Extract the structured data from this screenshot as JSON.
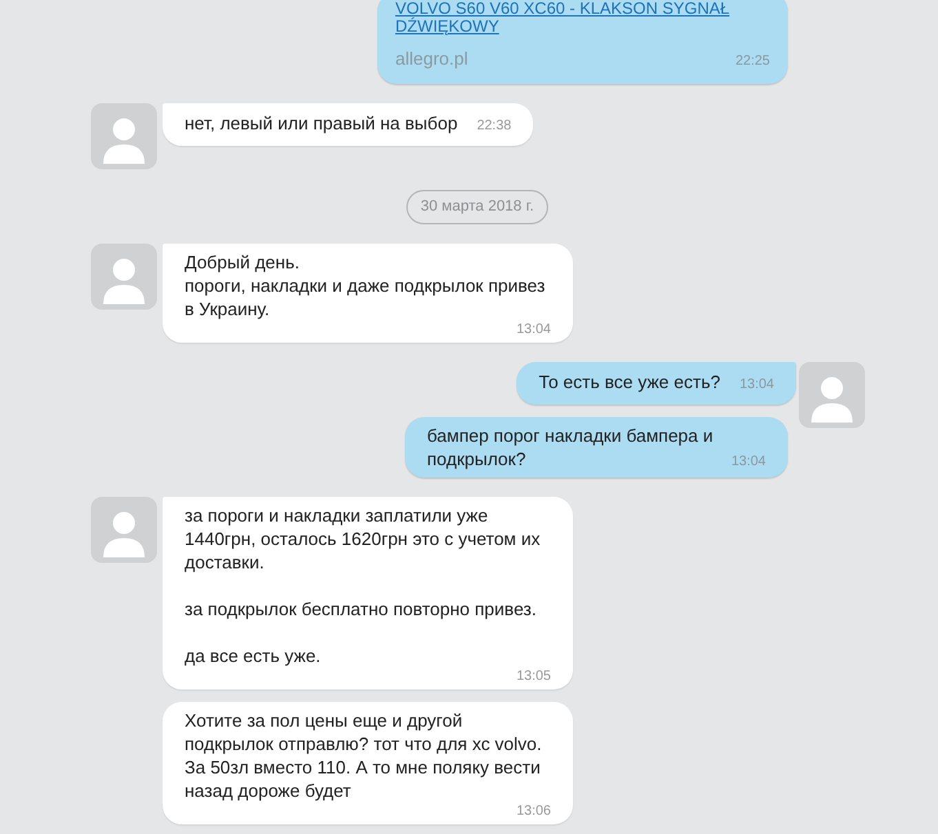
{
  "messages": [
    {
      "kind": "link",
      "outgoing": true,
      "avatar": false,
      "link_text": "VOLVO S60 V60 XC60 - KLAKSON SYGNAŁ DŹWIĘKOWY",
      "source": "allegro.pl",
      "time": "22:25"
    },
    {
      "kind": "short",
      "outgoing": false,
      "avatar": true,
      "text": "нет, левый или правый на выбор",
      "time": "22:38"
    },
    {
      "kind": "date",
      "text": "30 марта 2018 г."
    },
    {
      "kind": "long",
      "outgoing": false,
      "avatar": true,
      "text": "Добрый день.\nпороги, накладки и даже подкрылок привез в Украину.",
      "time": "13:04"
    },
    {
      "kind": "short",
      "outgoing": true,
      "avatar": true,
      "text": "То есть все уже есть?",
      "time": "13:04"
    },
    {
      "kind": "long_inline",
      "outgoing": true,
      "avatar": false,
      "text": "бампер порог накладки бампера и подкрылок?",
      "time": "13:04"
    },
    {
      "kind": "long",
      "outgoing": false,
      "avatar": true,
      "text": "за пороги и накладки заплатили уже 1440грн, осталось 1620грн это с учетом их доставки.\n\nза подкрылок бесплатно повторно привез.\n\nда все есть уже.",
      "time": "13:05"
    },
    {
      "kind": "long",
      "outgoing": false,
      "avatar": false,
      "text": "Хотите за пол цены еще и другой подкрылок отправлю? тот что для хс volvo. За 50зл вместо 110. А то мне поляку вести назад дороже будет",
      "time": "13:06"
    }
  ]
}
